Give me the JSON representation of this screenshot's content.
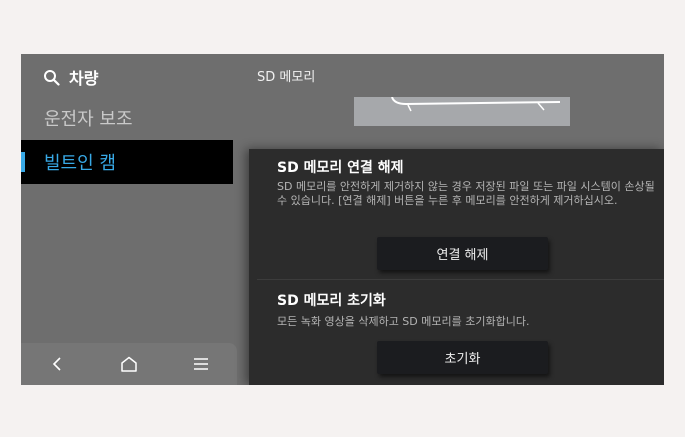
{
  "sidebar": {
    "search_label": "차량",
    "items": [
      {
        "label": "운전자 보조",
        "active": false
      },
      {
        "label": "빌트인 캠",
        "active": true
      }
    ]
  },
  "main": {
    "title": "SD 메모리"
  },
  "panel": {
    "disconnect": {
      "title": "SD 메모리 연결 해제",
      "description": "SD 메모리를 안전하게 제거하지 않는 경우 저장된 파일 또는 파일 시스템이 손상될 수 있습니다. [연결 해제] 버튼을 누른 후 메모리를 안전하게 제거하십시오.",
      "button_label": "연결 해제"
    },
    "format": {
      "title": "SD 메모리 초기화",
      "description": "모든 녹화 영상을 삭제하고 SD 메모리를 초기화합니다.",
      "button_label": "초기화"
    }
  },
  "navbar": {
    "icons": [
      "back-icon",
      "home-icon",
      "menu-icon"
    ]
  },
  "colors": {
    "accent": "#38a9e6",
    "background": "#6e6e6e",
    "panel": "#2c2c2c",
    "button": "#1b1c1f"
  }
}
